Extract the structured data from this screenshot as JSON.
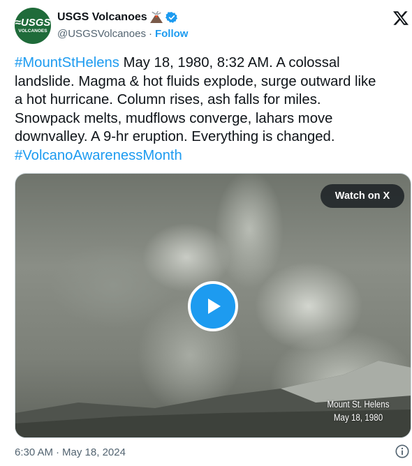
{
  "author": {
    "display_name": "USGS Volcanoes",
    "handle": "@USGSVolcanoes",
    "separator": "·",
    "follow_label": "Follow",
    "avatar_text_top": "≈USGS",
    "avatar_text_bottom": "VOLCANOES",
    "avatar_color": "#1f6b3a"
  },
  "icons": {
    "volcano": "volcano-emoji-icon",
    "verified": "verified-badge-icon",
    "x_logo": "x-logo-icon",
    "play": "play-icon",
    "info": "info-icon"
  },
  "tweet": {
    "lines": [
      {
        "hashtag": "#MountStHelens",
        "text": " May 18, 1980, 8:32 AM. A colossal"
      },
      {
        "hashtag": "",
        "text": "landslide. Magma & hot fluids explode, surge outward like"
      },
      {
        "hashtag": "",
        "text": "a hot hurricane. Column rises, ash falls for miles."
      },
      {
        "hashtag": "",
        "text": "Snowpack melts, mudflows converge, lahars move"
      },
      {
        "hashtag": "",
        "text": "downvalley. A 9-hr eruption. Everything is changed."
      },
      {
        "hashtag": "#VolcanoAwarenessMonth",
        "text": ""
      }
    ]
  },
  "media": {
    "watch_label": "Watch on X",
    "caption_line1": "Mount St. Helens",
    "caption_line2": "May 18, 1980"
  },
  "footer": {
    "time": "6:30 AM",
    "separator": "·",
    "date": "May 18, 2024"
  },
  "colors": {
    "link": "#1d9bf0",
    "text": "#0f1419",
    "muted": "#536471"
  }
}
